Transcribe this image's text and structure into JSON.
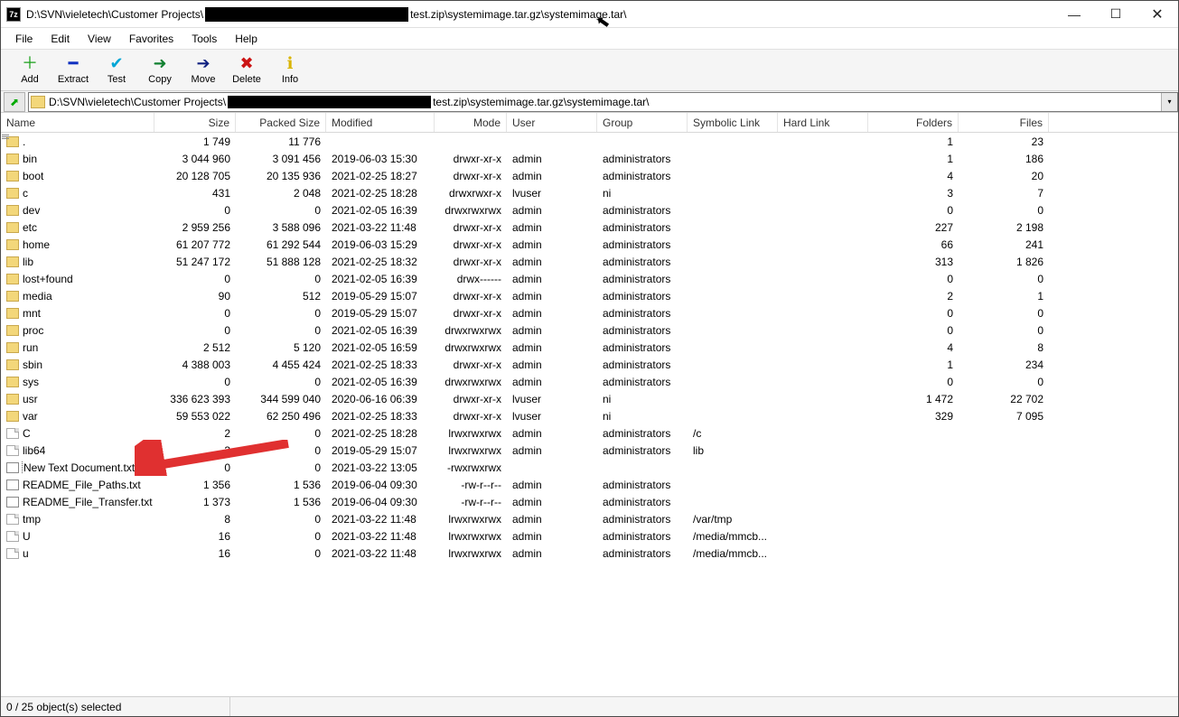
{
  "title": {
    "prefix": "D:\\SVN\\vieletech\\Customer Projects\\",
    "suffix": " test.zip\\systemimage.tar.gz\\systemimage.tar\\"
  },
  "menu": [
    "File",
    "Edit",
    "View",
    "Favorites",
    "Tools",
    "Help"
  ],
  "toolbar": [
    {
      "label": "Add",
      "glyph": "＋",
      "color": "#1aa11a"
    },
    {
      "label": "Extract",
      "glyph": "━",
      "color": "#1030c0"
    },
    {
      "label": "Test",
      "glyph": "✔",
      "color": "#00a6d6"
    },
    {
      "label": "Copy",
      "glyph": "➜",
      "color": "#108030"
    },
    {
      "label": "Move",
      "glyph": "➔",
      "color": "#102080"
    },
    {
      "label": "Delete",
      "glyph": "✖",
      "color": "#cc1414"
    },
    {
      "label": "Info",
      "glyph": "ℹ",
      "color": "#d9b400"
    }
  ],
  "address": {
    "prefix": "D:\\SVN\\vieletech\\Customer Projects\\",
    "suffix": " test.zip\\systemimage.tar.gz\\systemimage.tar\\"
  },
  "columns": [
    "Name",
    "Size",
    "Packed Size",
    "Modified",
    "Mode",
    "User",
    "Group",
    "Symbolic Link",
    "Hard Link",
    "Folders",
    "Files"
  ],
  "rows": [
    {
      "icon": "folder",
      "name": ".",
      "size": "1 749",
      "packed": "11 776",
      "mod": "",
      "mode": "",
      "user": "",
      "group": "",
      "sym": "",
      "hard": "",
      "folders": "1",
      "files": "23"
    },
    {
      "icon": "folder",
      "name": "bin",
      "size": "3 044 960",
      "packed": "3 091 456",
      "mod": "2019-06-03 15:30",
      "mode": "drwxr-xr-x",
      "user": "admin",
      "group": "administrators",
      "sym": "",
      "hard": "",
      "folders": "1",
      "files": "186"
    },
    {
      "icon": "folder",
      "name": "boot",
      "size": "20 128 705",
      "packed": "20 135 936",
      "mod": "2021-02-25 18:27",
      "mode": "drwxr-xr-x",
      "user": "admin",
      "group": "administrators",
      "sym": "",
      "hard": "",
      "folders": "4",
      "files": "20"
    },
    {
      "icon": "folder",
      "name": "c",
      "size": "431",
      "packed": "2 048",
      "mod": "2021-02-25 18:28",
      "mode": "drwxrwxr-x",
      "user": "lvuser",
      "group": "ni",
      "sym": "",
      "hard": "",
      "folders": "3",
      "files": "7"
    },
    {
      "icon": "folder",
      "name": "dev",
      "size": "0",
      "packed": "0",
      "mod": "2021-02-05 16:39",
      "mode": "drwxrwxrwx",
      "user": "admin",
      "group": "administrators",
      "sym": "",
      "hard": "",
      "folders": "0",
      "files": "0"
    },
    {
      "icon": "folder",
      "name": "etc",
      "size": "2 959 256",
      "packed": "3 588 096",
      "mod": "2021-03-22 11:48",
      "mode": "drwxr-xr-x",
      "user": "admin",
      "group": "administrators",
      "sym": "",
      "hard": "",
      "folders": "227",
      "files": "2 198"
    },
    {
      "icon": "folder",
      "name": "home",
      "size": "61 207 772",
      "packed": "61 292 544",
      "mod": "2019-06-03 15:29",
      "mode": "drwxr-xr-x",
      "user": "admin",
      "group": "administrators",
      "sym": "",
      "hard": "",
      "folders": "66",
      "files": "241"
    },
    {
      "icon": "folder",
      "name": "lib",
      "size": "51 247 172",
      "packed": "51 888 128",
      "mod": "2021-02-25 18:32",
      "mode": "drwxr-xr-x",
      "user": "admin",
      "group": "administrators",
      "sym": "",
      "hard": "",
      "folders": "313",
      "files": "1 826"
    },
    {
      "icon": "folder",
      "name": "lost+found",
      "size": "0",
      "packed": "0",
      "mod": "2021-02-05 16:39",
      "mode": "drwx------",
      "user": "admin",
      "group": "administrators",
      "sym": "",
      "hard": "",
      "folders": "0",
      "files": "0"
    },
    {
      "icon": "folder",
      "name": "media",
      "size": "90",
      "packed": "512",
      "mod": "2019-05-29 15:07",
      "mode": "drwxr-xr-x",
      "user": "admin",
      "group": "administrators",
      "sym": "",
      "hard": "",
      "folders": "2",
      "files": "1"
    },
    {
      "icon": "folder",
      "name": "mnt",
      "size": "0",
      "packed": "0",
      "mod": "2019-05-29 15:07",
      "mode": "drwxr-xr-x",
      "user": "admin",
      "group": "administrators",
      "sym": "",
      "hard": "",
      "folders": "0",
      "files": "0"
    },
    {
      "icon": "folder",
      "name": "proc",
      "size": "0",
      "packed": "0",
      "mod": "2021-02-05 16:39",
      "mode": "drwxrwxrwx",
      "user": "admin",
      "group": "administrators",
      "sym": "",
      "hard": "",
      "folders": "0",
      "files": "0"
    },
    {
      "icon": "folder",
      "name": "run",
      "size": "2 512",
      "packed": "5 120",
      "mod": "2021-02-05 16:59",
      "mode": "drwxrwxrwx",
      "user": "admin",
      "group": "administrators",
      "sym": "",
      "hard": "",
      "folders": "4",
      "files": "8"
    },
    {
      "icon": "folder",
      "name": "sbin",
      "size": "4 388 003",
      "packed": "4 455 424",
      "mod": "2021-02-25 18:33",
      "mode": "drwxr-xr-x",
      "user": "admin",
      "group": "administrators",
      "sym": "",
      "hard": "",
      "folders": "1",
      "files": "234"
    },
    {
      "icon": "folder",
      "name": "sys",
      "size": "0",
      "packed": "0",
      "mod": "2021-02-05 16:39",
      "mode": "drwxrwxrwx",
      "user": "admin",
      "group": "administrators",
      "sym": "",
      "hard": "",
      "folders": "0",
      "files": "0"
    },
    {
      "icon": "folder",
      "name": "usr",
      "size": "336 623 393",
      "packed": "344 599 040",
      "mod": "2020-06-16 06:39",
      "mode": "drwxr-xr-x",
      "user": "lvuser",
      "group": "ni",
      "sym": "",
      "hard": "",
      "folders": "1 472",
      "files": "22 702"
    },
    {
      "icon": "folder",
      "name": "var",
      "size": "59 553 022",
      "packed": "62 250 496",
      "mod": "2021-02-25 18:33",
      "mode": "drwxr-xr-x",
      "user": "lvuser",
      "group": "ni",
      "sym": "",
      "hard": "",
      "folders": "329",
      "files": "7 095"
    },
    {
      "icon": "file",
      "name": "C",
      "size": "2",
      "packed": "0",
      "mod": "2021-02-25 18:28",
      "mode": "lrwxrwxrwx",
      "user": "admin",
      "group": "administrators",
      "sym": "/c",
      "hard": "",
      "folders": "",
      "files": ""
    },
    {
      "icon": "file",
      "name": "lib64",
      "size": "3",
      "packed": "0",
      "mod": "2019-05-29 15:07",
      "mode": "lrwxrwxrwx",
      "user": "admin",
      "group": "administrators",
      "sym": "lib",
      "hard": "",
      "folders": "",
      "files": ""
    },
    {
      "icon": "txt",
      "name": "New Text Document.txt",
      "size": "0",
      "packed": "0",
      "mod": "2021-03-22 13:05",
      "mode": "-rwxrwxrwx",
      "user": "",
      "group": "",
      "sym": "",
      "hard": "",
      "folders": "",
      "files": "",
      "highlight": true
    },
    {
      "icon": "txt",
      "name": "README_File_Paths.txt",
      "size": "1 356",
      "packed": "1 536",
      "mod": "2019-06-04 09:30",
      "mode": "-rw-r--r--",
      "user": "admin",
      "group": "administrators",
      "sym": "",
      "hard": "",
      "folders": "",
      "files": ""
    },
    {
      "icon": "txt",
      "name": "README_File_Transfer.txt",
      "size": "1 373",
      "packed": "1 536",
      "mod": "2019-06-04 09:30",
      "mode": "-rw-r--r--",
      "user": "admin",
      "group": "administrators",
      "sym": "",
      "hard": "",
      "folders": "",
      "files": ""
    },
    {
      "icon": "file",
      "name": "tmp",
      "size": "8",
      "packed": "0",
      "mod": "2021-03-22 11:48",
      "mode": "lrwxrwxrwx",
      "user": "admin",
      "group": "administrators",
      "sym": "/var/tmp",
      "hard": "",
      "folders": "",
      "files": ""
    },
    {
      "icon": "file",
      "name": "U",
      "size": "16",
      "packed": "0",
      "mod": "2021-03-22 11:48",
      "mode": "lrwxrwxrwx",
      "user": "admin",
      "group": "administrators",
      "sym": "/media/mmcb...",
      "hard": "",
      "folders": "",
      "files": ""
    },
    {
      "icon": "file",
      "name": "u",
      "size": "16",
      "packed": "0",
      "mod": "2021-03-22 11:48",
      "mode": "lrwxrwxrwx",
      "user": "admin",
      "group": "administrators",
      "sym": "/media/mmcb...",
      "hard": "",
      "folders": "",
      "files": ""
    }
  ],
  "status": "0 / 25 object(s) selected"
}
